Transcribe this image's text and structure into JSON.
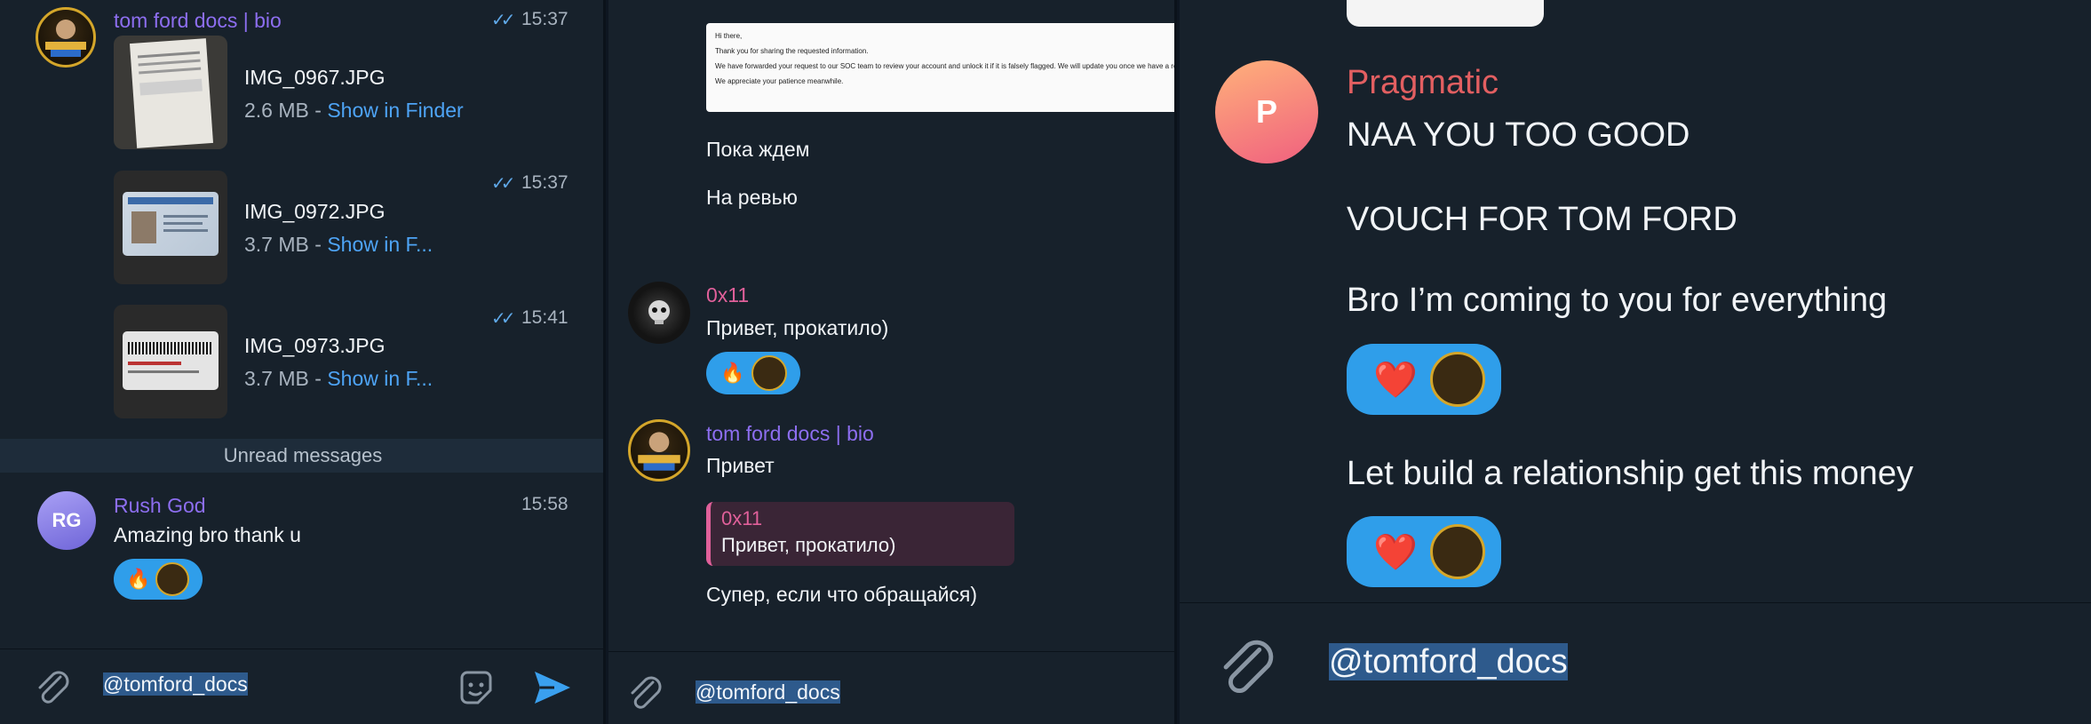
{
  "panel1": {
    "header": {
      "sender": "tom ford docs | bio",
      "time": "15:37"
    },
    "files": [
      {
        "name": "IMG_0967.JPG",
        "meta": "2.6 MB - ",
        "link": "Show in Finder",
        "time": ""
      },
      {
        "name": "IMG_0972.JPG",
        "meta": "3.7 MB - ",
        "link": "Show in F...",
        "time": "15:37"
      },
      {
        "name": "IMG_0973.JPG",
        "meta": "3.7 MB - ",
        "link": "Show in F...",
        "time": "15:41"
      }
    ],
    "unread_label": "Unread messages",
    "message": {
      "avatar_initials": "RG",
      "sender": "Rush God",
      "time": "15:58",
      "text": "Amazing bro thank u",
      "reactions": [
        "🔥"
      ]
    },
    "composer": {
      "text": "@tomford_docs"
    }
  },
  "panel2": {
    "email": {
      "line1": "Hi there,",
      "line2": "Thank you for sharing the requested information.",
      "line3": "We have forwarded your request to our SOC team to review your account and unlock it if it is falsely flagged. We will update you once we have a response.",
      "line4": "We appreciate your patience meanwhile."
    },
    "msg_wait": "Пока ждем",
    "msg_review": "На ревью",
    "reply1": {
      "sender": "0x11",
      "text": "Привет, прокатило)",
      "reactions": [
        "🔥"
      ]
    },
    "reply2": {
      "sender": "tom ford docs | bio",
      "text": "Привет",
      "quote_sender": "0x11",
      "quote_text": "Привет, прокатило)",
      "followup": "Супер, если что обращайся)"
    },
    "composer": {
      "text": "@tomford_docs"
    }
  },
  "panel3": {
    "message": {
      "avatar_initials": "P",
      "sender": "Pragmatic",
      "lines": [
        "NAA YOU TOO GOOD",
        "VOUCH FOR TOM FORD",
        "Bro I’m coming to you for everything",
        "Let build a relationship get this money"
      ],
      "reactions": [
        "❤️",
        "❤️"
      ]
    },
    "composer": {
      "text": "@tomford_docs"
    }
  },
  "colors": {
    "background": "#17212b",
    "accent": "#4ea4f6",
    "sender_purple": "#8d6ef0",
    "sender_pink": "#e25f61",
    "reaction_bg": "#2f9eea"
  }
}
